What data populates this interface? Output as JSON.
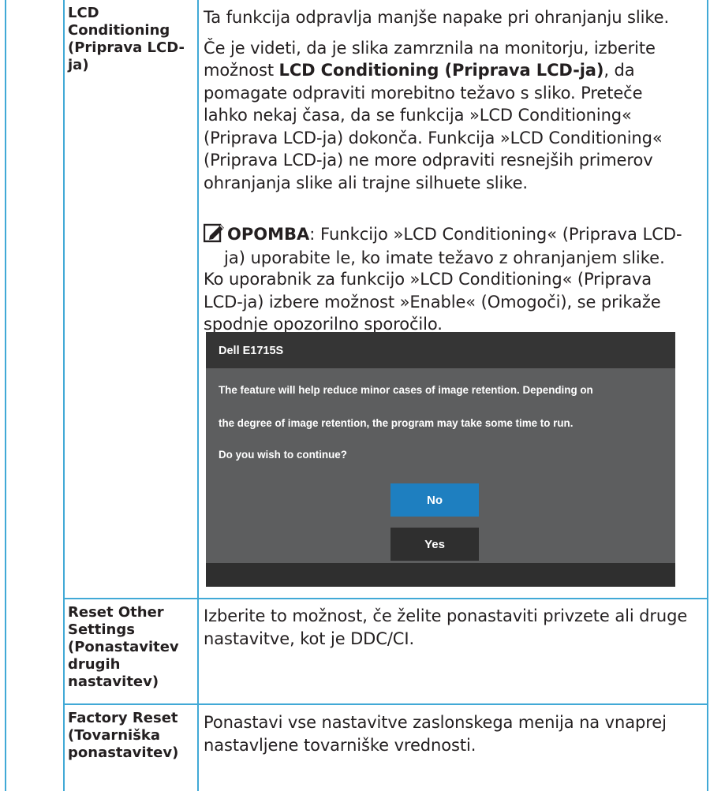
{
  "rows": [
    {
      "label": "LCD Conditioning (Priprava LCD-ja)",
      "label_lines": [
        "LCD",
        "Conditioning",
        "(Priprava LCD-",
        "ja)"
      ],
      "para1": "Ta funkcija odpravlja manjše napake pri ohranjanju slike.",
      "para2_lines": [
        "Če je videti, da je slika zamrznila na monitorju, izberite",
        "možnost ",
        "LCD Conditioning (Priprava LCD-ja)",
        ", da",
        "pomagate odpraviti morebitno težavo s sliko. Preteče",
        "lahko nekaj časa, da se funkcija »LCD Conditioning«",
        "(Priprava LCD-ja) dokonča. Funkcija »LCD Conditioning«",
        "(Priprava LCD-ja) ne more odpraviti resnejših primerov",
        "ohranjanja slike ali trajne silhuete slike."
      ],
      "note_title": "OPOMBA",
      "note_line1": ": Funkcijo »LCD Conditioning« (Priprava LCD-",
      "note_line2": "ja) uporabite le, ko imate težavo z ohranjanjem slike.",
      "para3_lines": [
        "Ko uporabnik za funkcijo »LCD Conditioning« (Priprava",
        "LCD-ja) izbere možnost »Enable« (Omogoči), se prikaže",
        "spodnje opozorilno sporočilo."
      ]
    },
    {
      "label_lines": [
        "Reset Other",
        "Settings",
        "(Ponastavitev",
        "drugih",
        "nastavitev)"
      ],
      "body_lines": [
        "Izberite to možnost, če želite ponastaviti privzete ali druge",
        "nastavitve, kot je DDC/CI."
      ]
    },
    {
      "label_lines": [
        "Factory Reset",
        "(Tovarniška",
        "ponastavitev)"
      ],
      "body_lines": [
        "Ponastavi vse nastavitve zaslonskega menija na vnaprej",
        "nastavljene tovarniške vrednosti."
      ]
    }
  ],
  "dialog": {
    "title": "Dell E1715S",
    "message_line1": "The feature will help reduce minor cases of image retention. Depending on",
    "message_line2": "the degree of image retention, the program may take some time to run.",
    "question": "Do you wish to continue?",
    "no_label": "No",
    "yes_label": "Yes"
  },
  "colors": {
    "border": "#41a9d6",
    "dialog_bg": "#5d5e5f",
    "dialog_header": "#353535",
    "button_no": "#1e7fc0",
    "button_yes": "#2f2f2f"
  },
  "icons": {
    "note": "pencil-note-icon"
  }
}
